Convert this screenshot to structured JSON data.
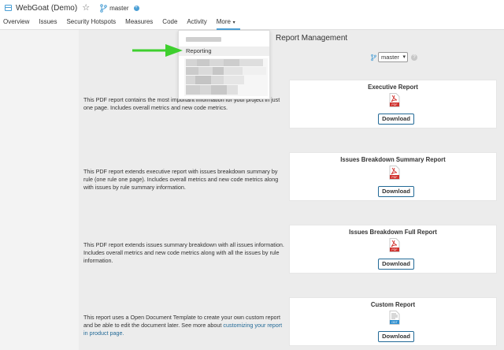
{
  "header": {
    "project_title": "WebGoat (Demo)",
    "branch": "master"
  },
  "nav": [
    {
      "label": "Overview"
    },
    {
      "label": "Issues"
    },
    {
      "label": "Security Hotspots"
    },
    {
      "label": "Measures"
    },
    {
      "label": "Code"
    },
    {
      "label": "Activity"
    },
    {
      "label": "More",
      "active": true
    }
  ],
  "dropdown": {
    "item_label": "Reporting"
  },
  "page": {
    "heading": "Report Management",
    "branch_select_value": "master"
  },
  "reports": [
    {
      "title": "Executive Report",
      "description": "This PDF report contains the most important information for your project in just one page. Includes overall metrics and new code metrics.",
      "icon_label": "PDF",
      "button": "Download"
    },
    {
      "title": "Issues Breakdown Summary Report",
      "description": "This PDF report extends executive report with issues breakdown summary by rule (one rule one page). Includes overall metrics and new code metrics along with issues by rule summary information.",
      "icon_label": "PDF",
      "button": "Download"
    },
    {
      "title": "Issues Breakdown Full Report",
      "description": "This PDF report extends issues summary breakdown with all issues information. Includes overall metrics and new code metrics along with all the issues by rule information.",
      "icon_label": "PDF",
      "button": "Download"
    },
    {
      "title": "Custom Report",
      "description": "This report uses a Open Document Template to create your own custom report and be able to edit the document later. See more about ",
      "link_text": "customizing your report in product page.",
      "icon_label": "ODT",
      "button": "Download"
    }
  ],
  "colors": {
    "accent": "#4b9fd5",
    "link": "#236a97",
    "pdf_red": "#d0312d",
    "arrow_green": "#3ecf2e"
  }
}
